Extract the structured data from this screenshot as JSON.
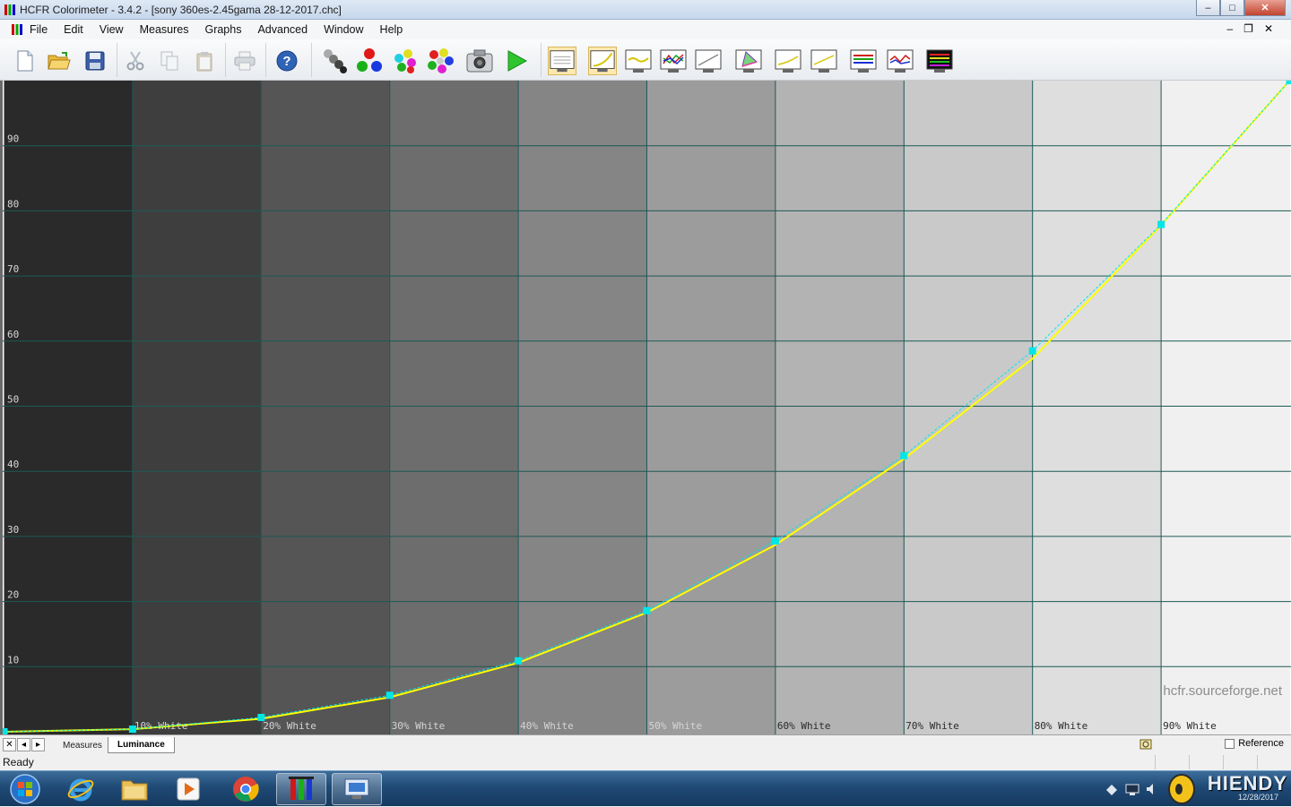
{
  "window": {
    "title": "HCFR Colorimeter - 3.4.2 - [sony 360es-2.45gama 28-12-2017.chc]",
    "minimize_glyph": "–",
    "maximize_glyph": "□",
    "close_glyph": "✕"
  },
  "menu": {
    "items": [
      "File",
      "Edit",
      "View",
      "Measures",
      "Graphs",
      "Advanced",
      "Window",
      "Help"
    ],
    "mdi_minimize": "–",
    "mdi_restore": "❐",
    "mdi_close": "✕"
  },
  "toolbar": {
    "buttons": [
      "new-icon",
      "open-icon",
      "save-icon",
      "cut-icon",
      "copy-icon",
      "paste-icon",
      "print-icon",
      "help-icon",
      "measure-grays-icon",
      "measure-primaries-icon",
      "measure-secondaries-icon",
      "measure-all-icon",
      "snapshot-icon",
      "play-icon",
      "view-measures-icon",
      "view-luminance-icon",
      "view-gamma-icon",
      "view-rgb-icon",
      "view-colortemp-icon",
      "view-cie-icon",
      "view-saturation-icon",
      "view-saturation2-icon",
      "view-near-black-icon",
      "view-near-white-icon",
      "view-saturation-shift-icon"
    ]
  },
  "chart_data": {
    "type": "line",
    "title": "",
    "xlabel": "",
    "ylabel": "",
    "ylim": [
      0,
      100
    ],
    "y_ticks": [
      "10",
      "20",
      "30",
      "40",
      "50",
      "60",
      "70",
      "80",
      "90"
    ],
    "x_labels": [
      "10% White",
      "20% White",
      "30% White",
      "40% White",
      "50% White",
      "60% White",
      "70% White",
      "80% White",
      "90% White"
    ],
    "band_colors": [
      "#2a2a2a",
      "#3e3e3e",
      "#555555",
      "#6d6d6d",
      "#858585",
      "#9c9c9c",
      "#b3b3b3",
      "#c9c9c9",
      "#dedede",
      "#f0f0f0"
    ],
    "grid": true,
    "watermark": "hcfr.sourceforge.net",
    "series": [
      {
        "color": "#ffff00",
        "style": "solid",
        "x": [
          0,
          10,
          20,
          30,
          40,
          50,
          60,
          70,
          80,
          90,
          100
        ],
        "y": [
          0,
          0.4,
          2.0,
          5.3,
          10.6,
          18.3,
          28.7,
          41.9,
          57.3,
          77.8,
          100
        ]
      },
      {
        "color": "#00e6e6",
        "style": "dashed",
        "markers": true,
        "x": [
          0,
          10,
          20,
          30,
          40,
          50,
          60,
          70,
          80,
          90,
          100
        ],
        "y": [
          0,
          0.4,
          2.2,
          5.6,
          10.9,
          18.6,
          29.3,
          42.4,
          58.5,
          77.9,
          100
        ]
      }
    ]
  },
  "tabs": {
    "close_glyph": "✕",
    "prev_glyph": "◂",
    "next_glyph": "▸",
    "items": [
      "Measures",
      "Luminance"
    ],
    "active": "Luminance",
    "reference_label": "Reference"
  },
  "status": {
    "text": "Ready"
  },
  "taskbar": {
    "apps": [
      "start-orb-icon",
      "internet-explorer-icon",
      "file-explorer-icon",
      "media-player-icon",
      "chrome-icon",
      "hcfr-icon",
      "remote-desktop-icon"
    ],
    "brand": "HIENDY",
    "date": "12/28/2017"
  }
}
